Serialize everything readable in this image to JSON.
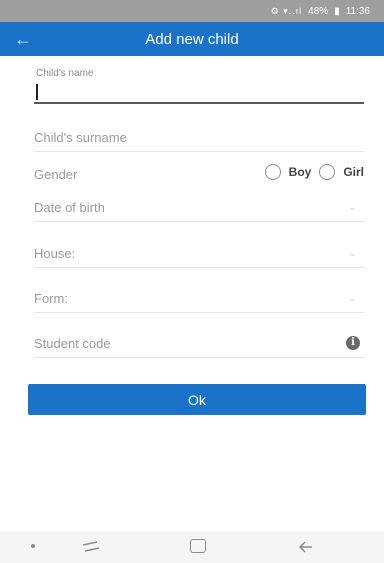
{
  "status_bar": {
    "signal": "⚙ ▾..ıl",
    "battery": "48%",
    "battery_icon": "▮",
    "time": "11:36"
  },
  "app_bar": {
    "title": "Add new child",
    "back_icon": "←"
  },
  "form": {
    "name": {
      "label": "Child's name",
      "value": ""
    },
    "surname": {
      "placeholder": "Child's surname"
    },
    "gender": {
      "label": "Gender",
      "options": [
        {
          "label": "Boy"
        },
        {
          "label": "Girl"
        }
      ]
    },
    "date_of_birth": {
      "placeholder": "Date of birth",
      "caret": "⌄"
    },
    "house": {
      "placeholder": "House:",
      "caret": "⌄"
    },
    "form_group": {
      "placeholder": "Form:",
      "caret": "⌄"
    },
    "student_code": {
      "placeholder": "Student code",
      "info_icon": "i"
    }
  },
  "ok_button": {
    "label": "Ok"
  },
  "colors": {
    "primary": "#1a73c8",
    "status_bar": "#9e9e9e",
    "divider": "#e6e6e6"
  }
}
